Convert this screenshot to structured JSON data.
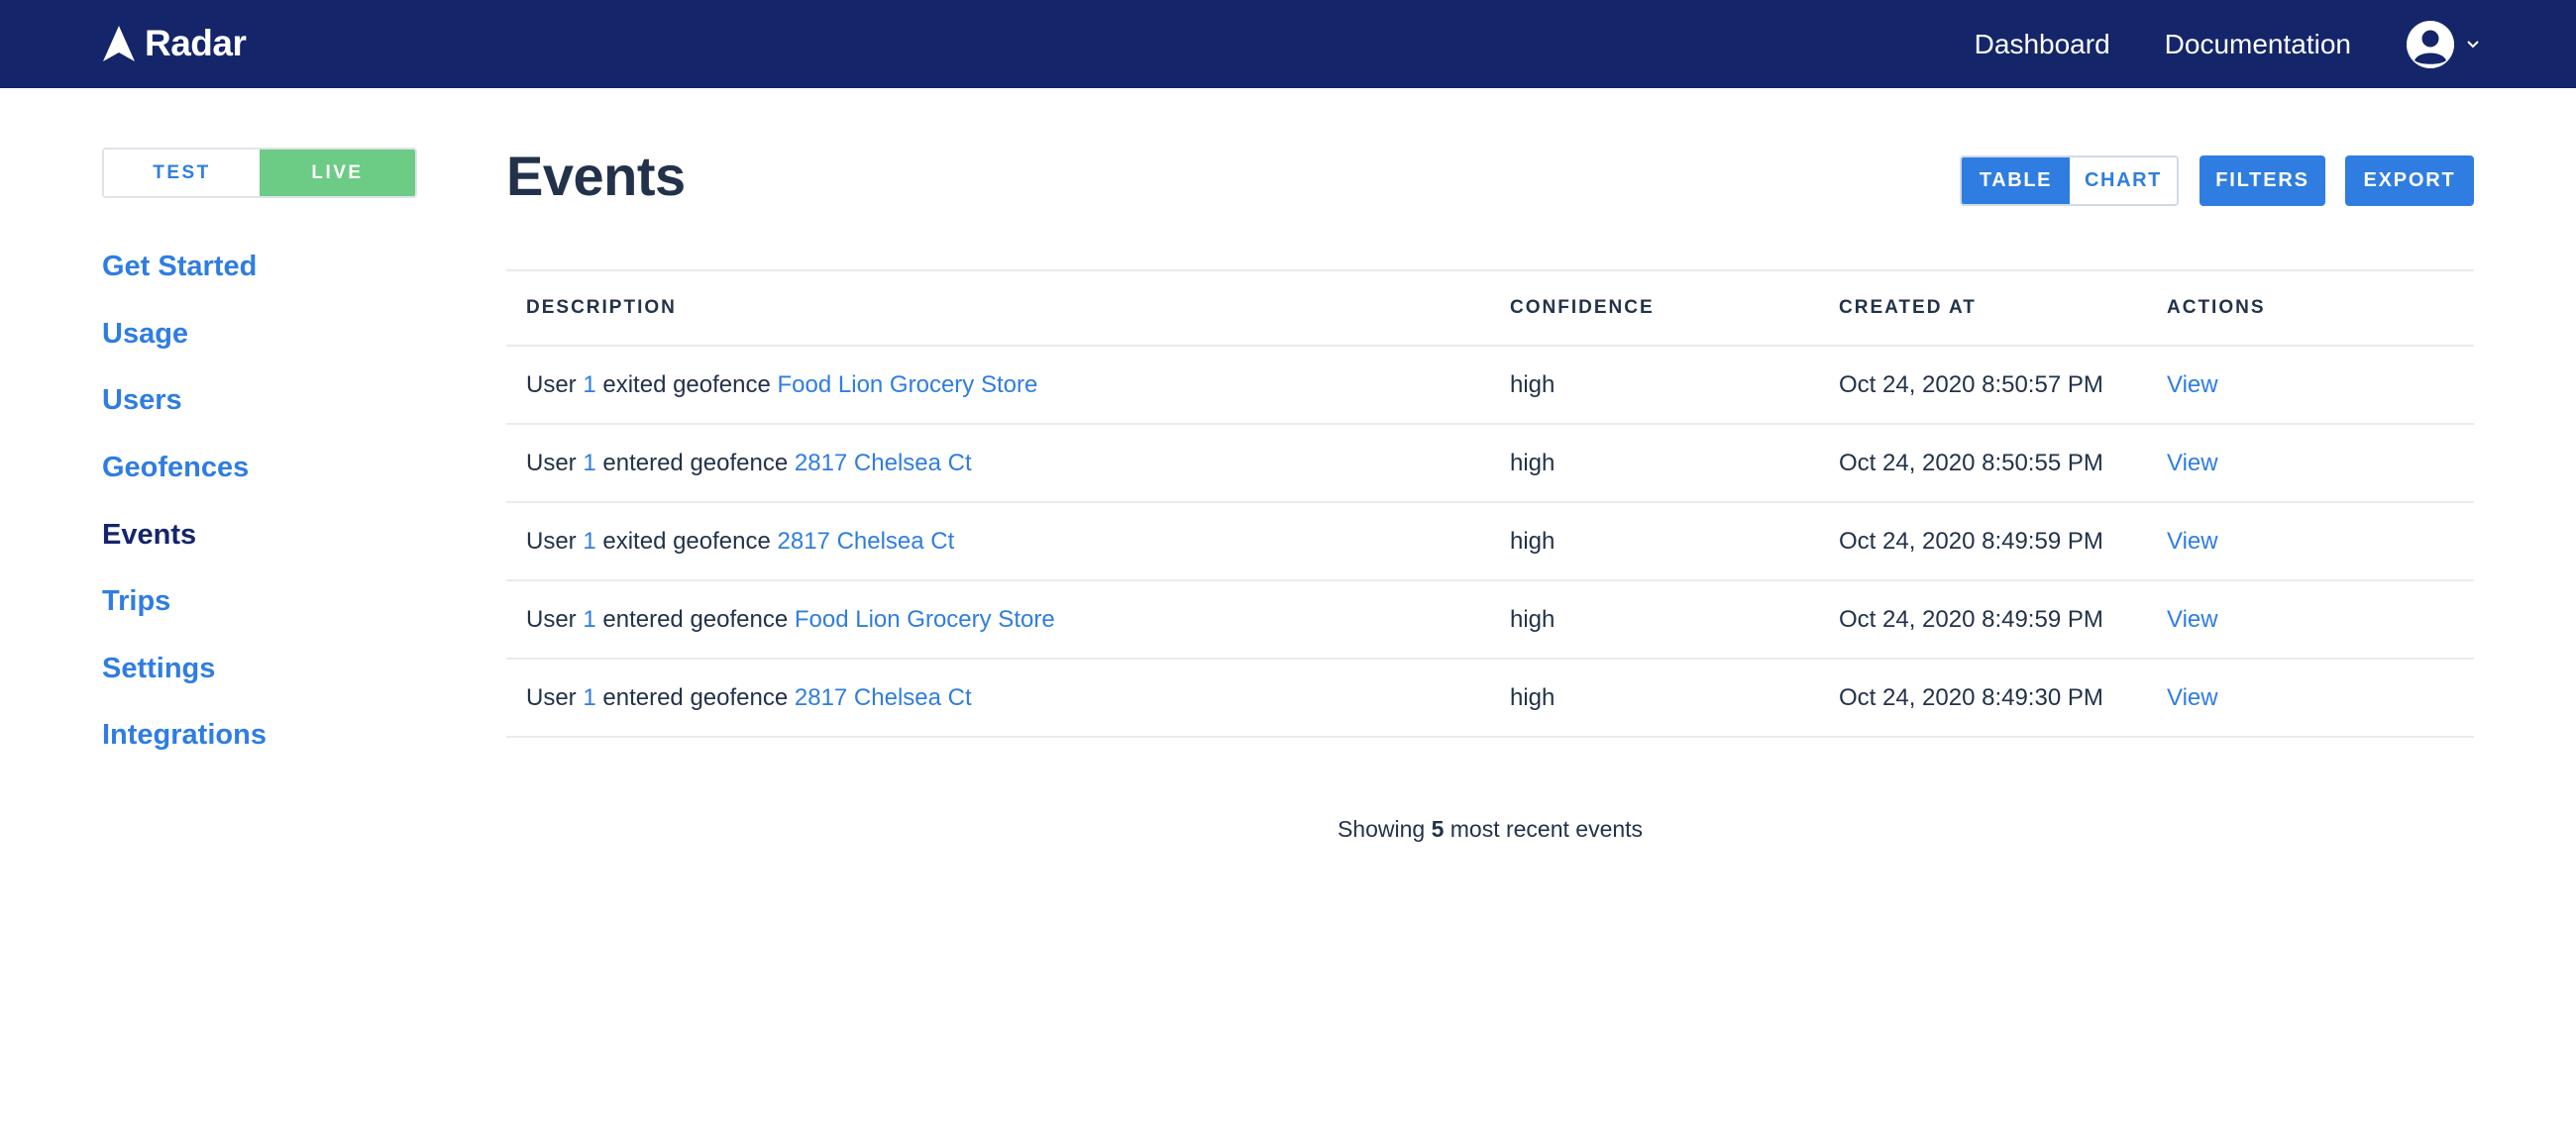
{
  "header": {
    "brand": "Radar",
    "nav": {
      "dashboard": "Dashboard",
      "documentation": "Documentation"
    }
  },
  "sidebar": {
    "env_toggle": {
      "test": "TEST",
      "live": "LIVE",
      "selected": "LIVE"
    },
    "items": [
      {
        "label": "Get Started"
      },
      {
        "label": "Usage"
      },
      {
        "label": "Users"
      },
      {
        "label": "Geofences"
      },
      {
        "label": "Events",
        "active": true
      },
      {
        "label": "Trips"
      },
      {
        "label": "Settings"
      },
      {
        "label": "Integrations"
      }
    ]
  },
  "main": {
    "title": "Events",
    "view_toggle": {
      "table": "TABLE",
      "chart": "CHART",
      "selected": "TABLE"
    },
    "filters_label": "FILTERS",
    "export_label": "EXPORT",
    "table": {
      "headers": {
        "description": "DESCRIPTION",
        "confidence": "CONFIDENCE",
        "created_at": "CREATED AT",
        "actions": "ACTIONS"
      },
      "rows": [
        {
          "user_prefix": "User",
          "user_id": "1",
          "action": "exited geofence",
          "geofence": "Food Lion Grocery Store",
          "confidence": "high",
          "created_at": "Oct 24, 2020 8:50:57 PM",
          "action_link": "View"
        },
        {
          "user_prefix": "User",
          "user_id": "1",
          "action": "entered geofence",
          "geofence": "2817 Chelsea Ct",
          "confidence": "high",
          "created_at": "Oct 24, 2020 8:50:55 PM",
          "action_link": "View"
        },
        {
          "user_prefix": "User",
          "user_id": "1",
          "action": "exited geofence",
          "geofence": "2817 Chelsea Ct",
          "confidence": "high",
          "created_at": "Oct 24, 2020 8:49:59 PM",
          "action_link": "View"
        },
        {
          "user_prefix": "User",
          "user_id": "1",
          "action": "entered geofence",
          "geofence": "Food Lion Grocery Store",
          "confidence": "high",
          "created_at": "Oct 24, 2020 8:49:59 PM",
          "action_link": "View"
        },
        {
          "user_prefix": "User",
          "user_id": "1",
          "action": "entered geofence",
          "geofence": "2817 Chelsea Ct",
          "confidence": "high",
          "created_at": "Oct 24, 2020 8:49:30 PM",
          "action_link": "View"
        }
      ]
    },
    "footer": {
      "prefix": "Showing",
      "count": "5",
      "suffix": "most recent events"
    }
  },
  "colors": {
    "topbar": "#14256a",
    "accent": "#2f7de1",
    "live": "#6ccb85",
    "text": "#22324a"
  },
  "icons": {
    "logo": "radar-logo-icon",
    "account": "user-avatar-icon",
    "account_menu": "chevron-down-icon"
  }
}
